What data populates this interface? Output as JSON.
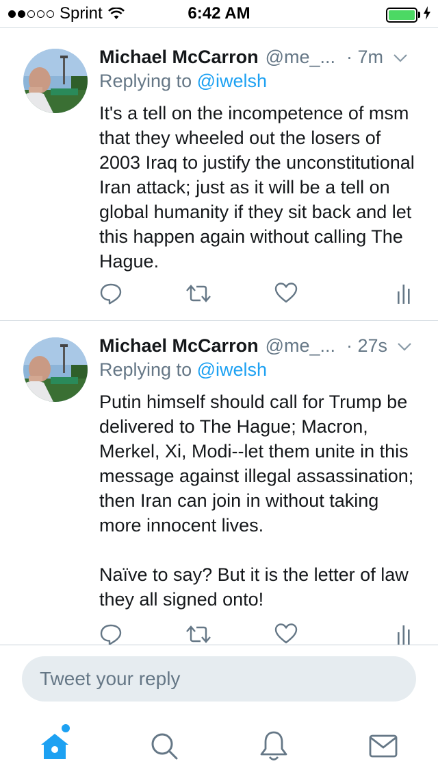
{
  "status_bar": {
    "carrier": "Sprint",
    "time": "6:42 AM",
    "battery_level": 1.0,
    "battery_color": "#4cd964",
    "signal_bars_filled": 2,
    "signal_bars_total": 5
  },
  "tweets": [
    {
      "author": "Michael McCarron",
      "handle": "@me_...",
      "time_ago": "· 7m",
      "replying_prefix": "Replying to",
      "replying_to": "@iwelsh",
      "text": "It's a tell on the incompetence of msm that they wheeled out the losers of 2003 Iraq to justify the unconstitutional Iran attack; just as it will be a tell on global humanity if they sit back and let this happen again without calling The Hague.",
      "actions": [
        "reply-icon",
        "retweet-icon",
        "like-icon",
        "analytics-icon"
      ]
    },
    {
      "author": "Michael McCarron",
      "handle": "@me_...",
      "time_ago": "· 27s",
      "replying_prefix": "Replying to",
      "replying_to": "@iwelsh",
      "text": "Putin himself should call for Trump be delivered to The Hague; Macron, Merkel, Xi, Modi--let them unite in this message against illegal assassination; then Iran can join in without taking more innocent lives.\n\nNaïve to say?  But it is the letter of law they all signed onto!",
      "actions": [
        "reply-icon",
        "retweet-icon",
        "like-icon",
        "analytics-icon"
      ]
    }
  ],
  "reply_bar": {
    "placeholder": "Tweet your reply"
  },
  "tab_bar": {
    "tabs": [
      "home-icon",
      "search-icon",
      "notifications-icon",
      "messages-icon"
    ],
    "active_tab": "home-icon",
    "home_has_new": true
  },
  "colors": {
    "accent": "#1da1f2",
    "secondary_text": "#657786",
    "icon_gray": "#657786"
  }
}
